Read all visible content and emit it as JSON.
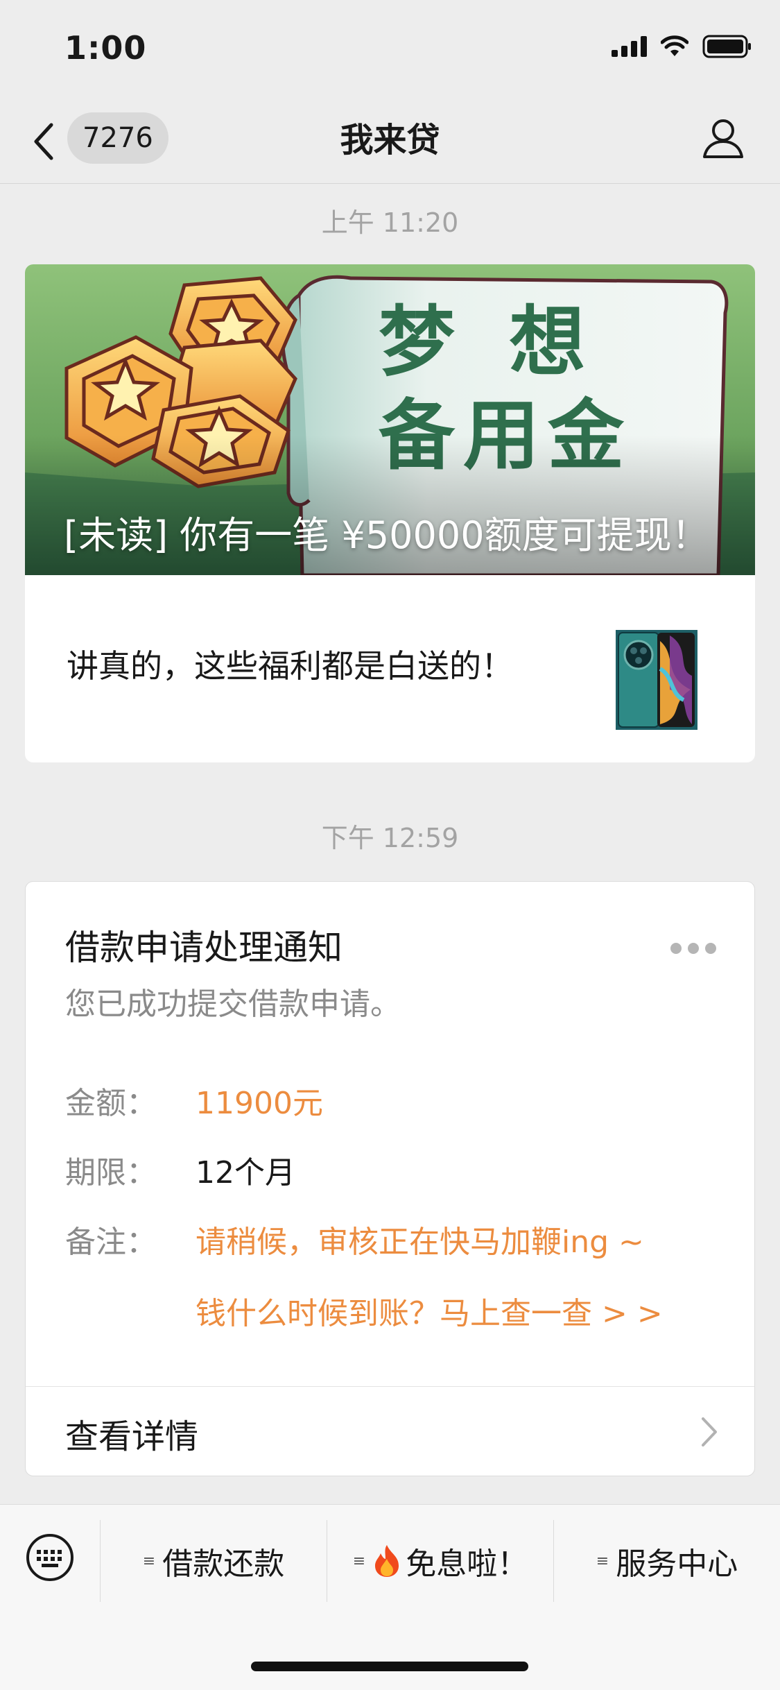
{
  "status_bar": {
    "time": "1:00"
  },
  "nav": {
    "unread_count": "7276",
    "title": "我来贷"
  },
  "messages": [
    {
      "timestamp": "上午 11:20"
    },
    {
      "timestamp": "下午 12:59"
    }
  ],
  "article": {
    "banner_caption": "[未读] 你有一笔 ¥50000额度可提现！",
    "banner_art_text": [
      "梦 想",
      "备用金"
    ],
    "sub_title": "讲真的，这些福利都是白送的！"
  },
  "notice": {
    "title": "借款申请处理通知",
    "description": "您已成功提交借款申请。",
    "fields": [
      {
        "label": "金额：",
        "value": "11900元"
      },
      {
        "label": "期限：",
        "value": "12个月"
      },
      {
        "label": "备注：",
        "value": "请稍候，审核正在快马加鞭ing ~",
        "value2": "钱什么时候到账？马上查一查 > >"
      }
    ],
    "detail_label": "查看详情"
  },
  "bottom_menu": {
    "items": [
      {
        "label": "借款还款"
      },
      {
        "label": "免息啦！"
      },
      {
        "label": "服务中心"
      }
    ]
  },
  "colors": {
    "accent_orange": "#ec8c3f",
    "background": "#ededed",
    "banner_green": "#7fb86a"
  }
}
